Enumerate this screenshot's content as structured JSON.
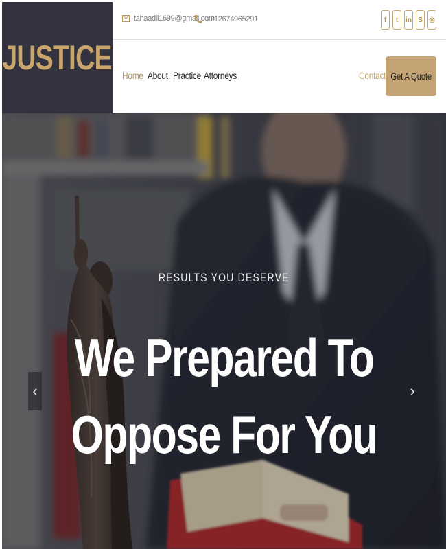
{
  "brand": {
    "logo": "JUSTICE"
  },
  "topbar": {
    "email": "tahaadil1699@gmail.com",
    "phone": "+212674965291",
    "socials": [
      {
        "icon": "facebook-icon",
        "glyph": "f"
      },
      {
        "icon": "twitter-icon",
        "glyph": "t"
      },
      {
        "icon": "linkedin-icon",
        "glyph": "in"
      },
      {
        "icon": "skype-icon",
        "glyph": "S"
      },
      {
        "icon": "instagram-icon",
        "glyph": "◎"
      }
    ]
  },
  "nav": {
    "home": "Home",
    "about": "About",
    "practice": "Practice",
    "attorneys": "Attorneys",
    "contact": "Contact",
    "cta": "Get A Quote"
  },
  "hero": {
    "eyebrow": "RESULTS YOU DESERVE",
    "line1": "We Prepared To",
    "line2": "Oppose For You",
    "prev": "‹",
    "next": "›"
  },
  "colors": {
    "accent": "#c4a474",
    "dark": "#32333f"
  }
}
